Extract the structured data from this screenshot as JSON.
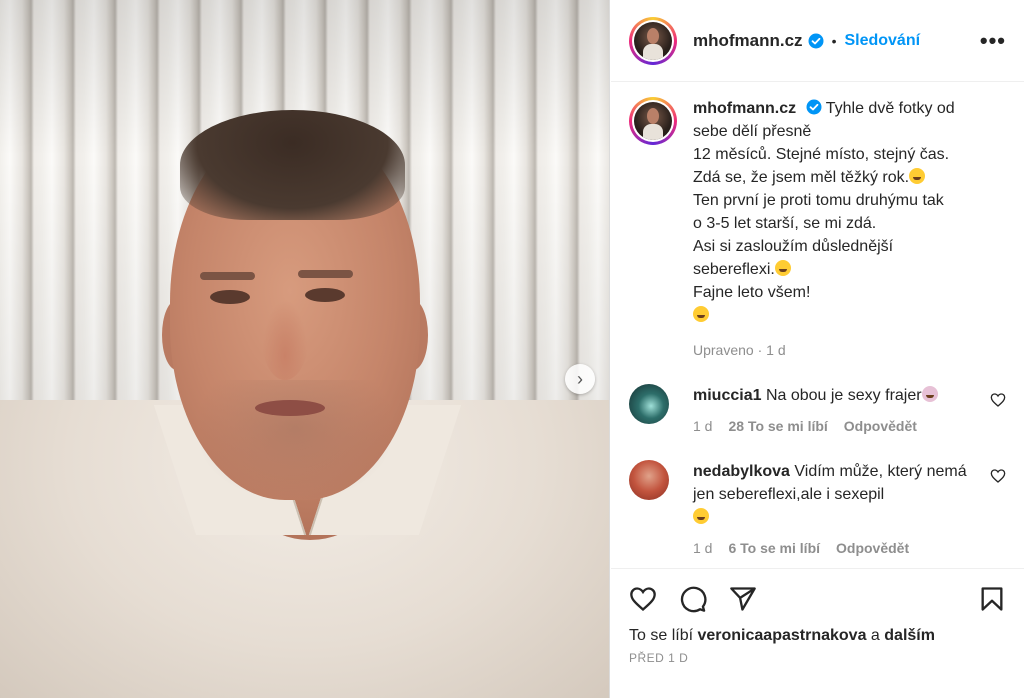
{
  "post": {
    "username": "mhofmann.cz",
    "separator": "•",
    "follow_label": "Sledování",
    "more_label": "•••"
  },
  "caption": {
    "username": "mhofmann.cz",
    "lines": [
      "Tyhle dvě fotky od",
      "sebe dělí přesně",
      "12 měsíců. Stejné místo, stejný čas.",
      "Zdá se, že jsem měl těžký rok.",
      "Ten první je proti tomu druhýmu tak",
      "o 3-5 let starší, se mi zdá.",
      "Asi si zasloužím důslednější",
      "sebereflexi.",
      "Fajne leto všem!"
    ],
    "meta": "Upraveno · 1 d"
  },
  "comments": [
    {
      "username": "miuccia1",
      "text": "Na obou je sexy frajer",
      "time": "1 d",
      "likes": "28 To se mi líbí",
      "reply": "Odpovědět"
    },
    {
      "username": "nedabylkova",
      "text": "Vidím může, který nemá jen sebereflexi,ale i sexepil",
      "time": "1 d",
      "likes": "6 To se mi líbí",
      "reply": "Odpovědět"
    }
  ],
  "footer": {
    "likes_prefix": "To se líbí",
    "likes_user": "veronicaapastrnakova",
    "likes_and": "a",
    "likes_others": "dalším",
    "posted_ago": "PŘED 1 D"
  },
  "icons": {
    "next": "chevron-right-icon",
    "like": "heart-icon",
    "comment": "comment-icon",
    "share": "send-icon",
    "save": "bookmark-icon",
    "verified": "verified-badge-icon"
  },
  "colors": {
    "accent": "#0095f6",
    "text": "#262626",
    "muted": "#8e8e8e"
  }
}
